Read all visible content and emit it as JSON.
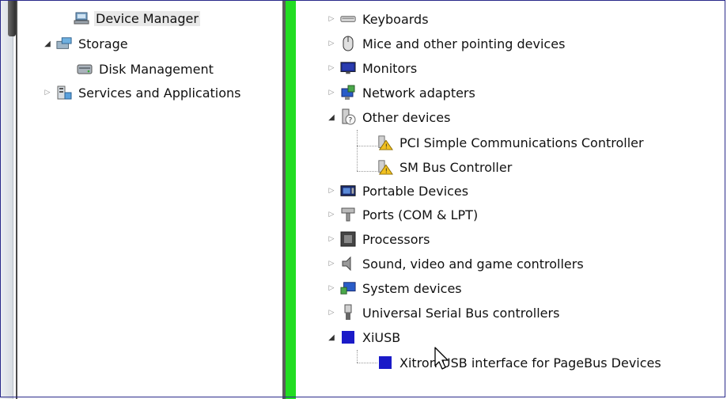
{
  "left_tree": {
    "items": [
      {
        "label": "Device Manager",
        "icon": "device-manager-icon"
      },
      {
        "label": "Storage",
        "icon": "storage-icon",
        "expander": "expanded"
      },
      {
        "label": "Disk Management",
        "icon": "disk-management-icon"
      },
      {
        "label": "Services and Applications",
        "icon": "services-icon",
        "expander": "collapsed"
      }
    ]
  },
  "device_tree": {
    "items": [
      {
        "label": "Keyboards",
        "icon": "keyboard-icon"
      },
      {
        "label": "Mice and other pointing devices",
        "icon": "mouse-icon"
      },
      {
        "label": "Monitors",
        "icon": "monitor-icon"
      },
      {
        "label": "Network adapters",
        "icon": "network-adapter-icon"
      },
      {
        "label": "Other devices",
        "icon": "other-devices-icon",
        "expander": "expanded"
      },
      {
        "label": "PCI Simple Communications Controller",
        "icon": "warning-device-icon"
      },
      {
        "label": "SM Bus Controller",
        "icon": "warning-device-icon"
      },
      {
        "label": "Portable Devices",
        "icon": "portable-devices-icon"
      },
      {
        "label": "Ports (COM & LPT)",
        "icon": "ports-icon"
      },
      {
        "label": "Processors",
        "icon": "processor-icon"
      },
      {
        "label": "Sound, video and game controllers",
        "icon": "sound-icon"
      },
      {
        "label": "System devices",
        "icon": "system-devices-icon"
      },
      {
        "label": "Universal Serial Bus controllers",
        "icon": "usb-icon"
      },
      {
        "label": "XiUSB",
        "icon": "xiusb-icon",
        "expander": "expanded"
      },
      {
        "label": "Xitron USB interface for PageBus Devices",
        "icon": "xiusb-device-icon"
      }
    ]
  },
  "colors": {
    "splitter_green": "#22dd22",
    "xiusb_blue": "#1a1ac8",
    "warning_yellow": "#f0c020"
  }
}
